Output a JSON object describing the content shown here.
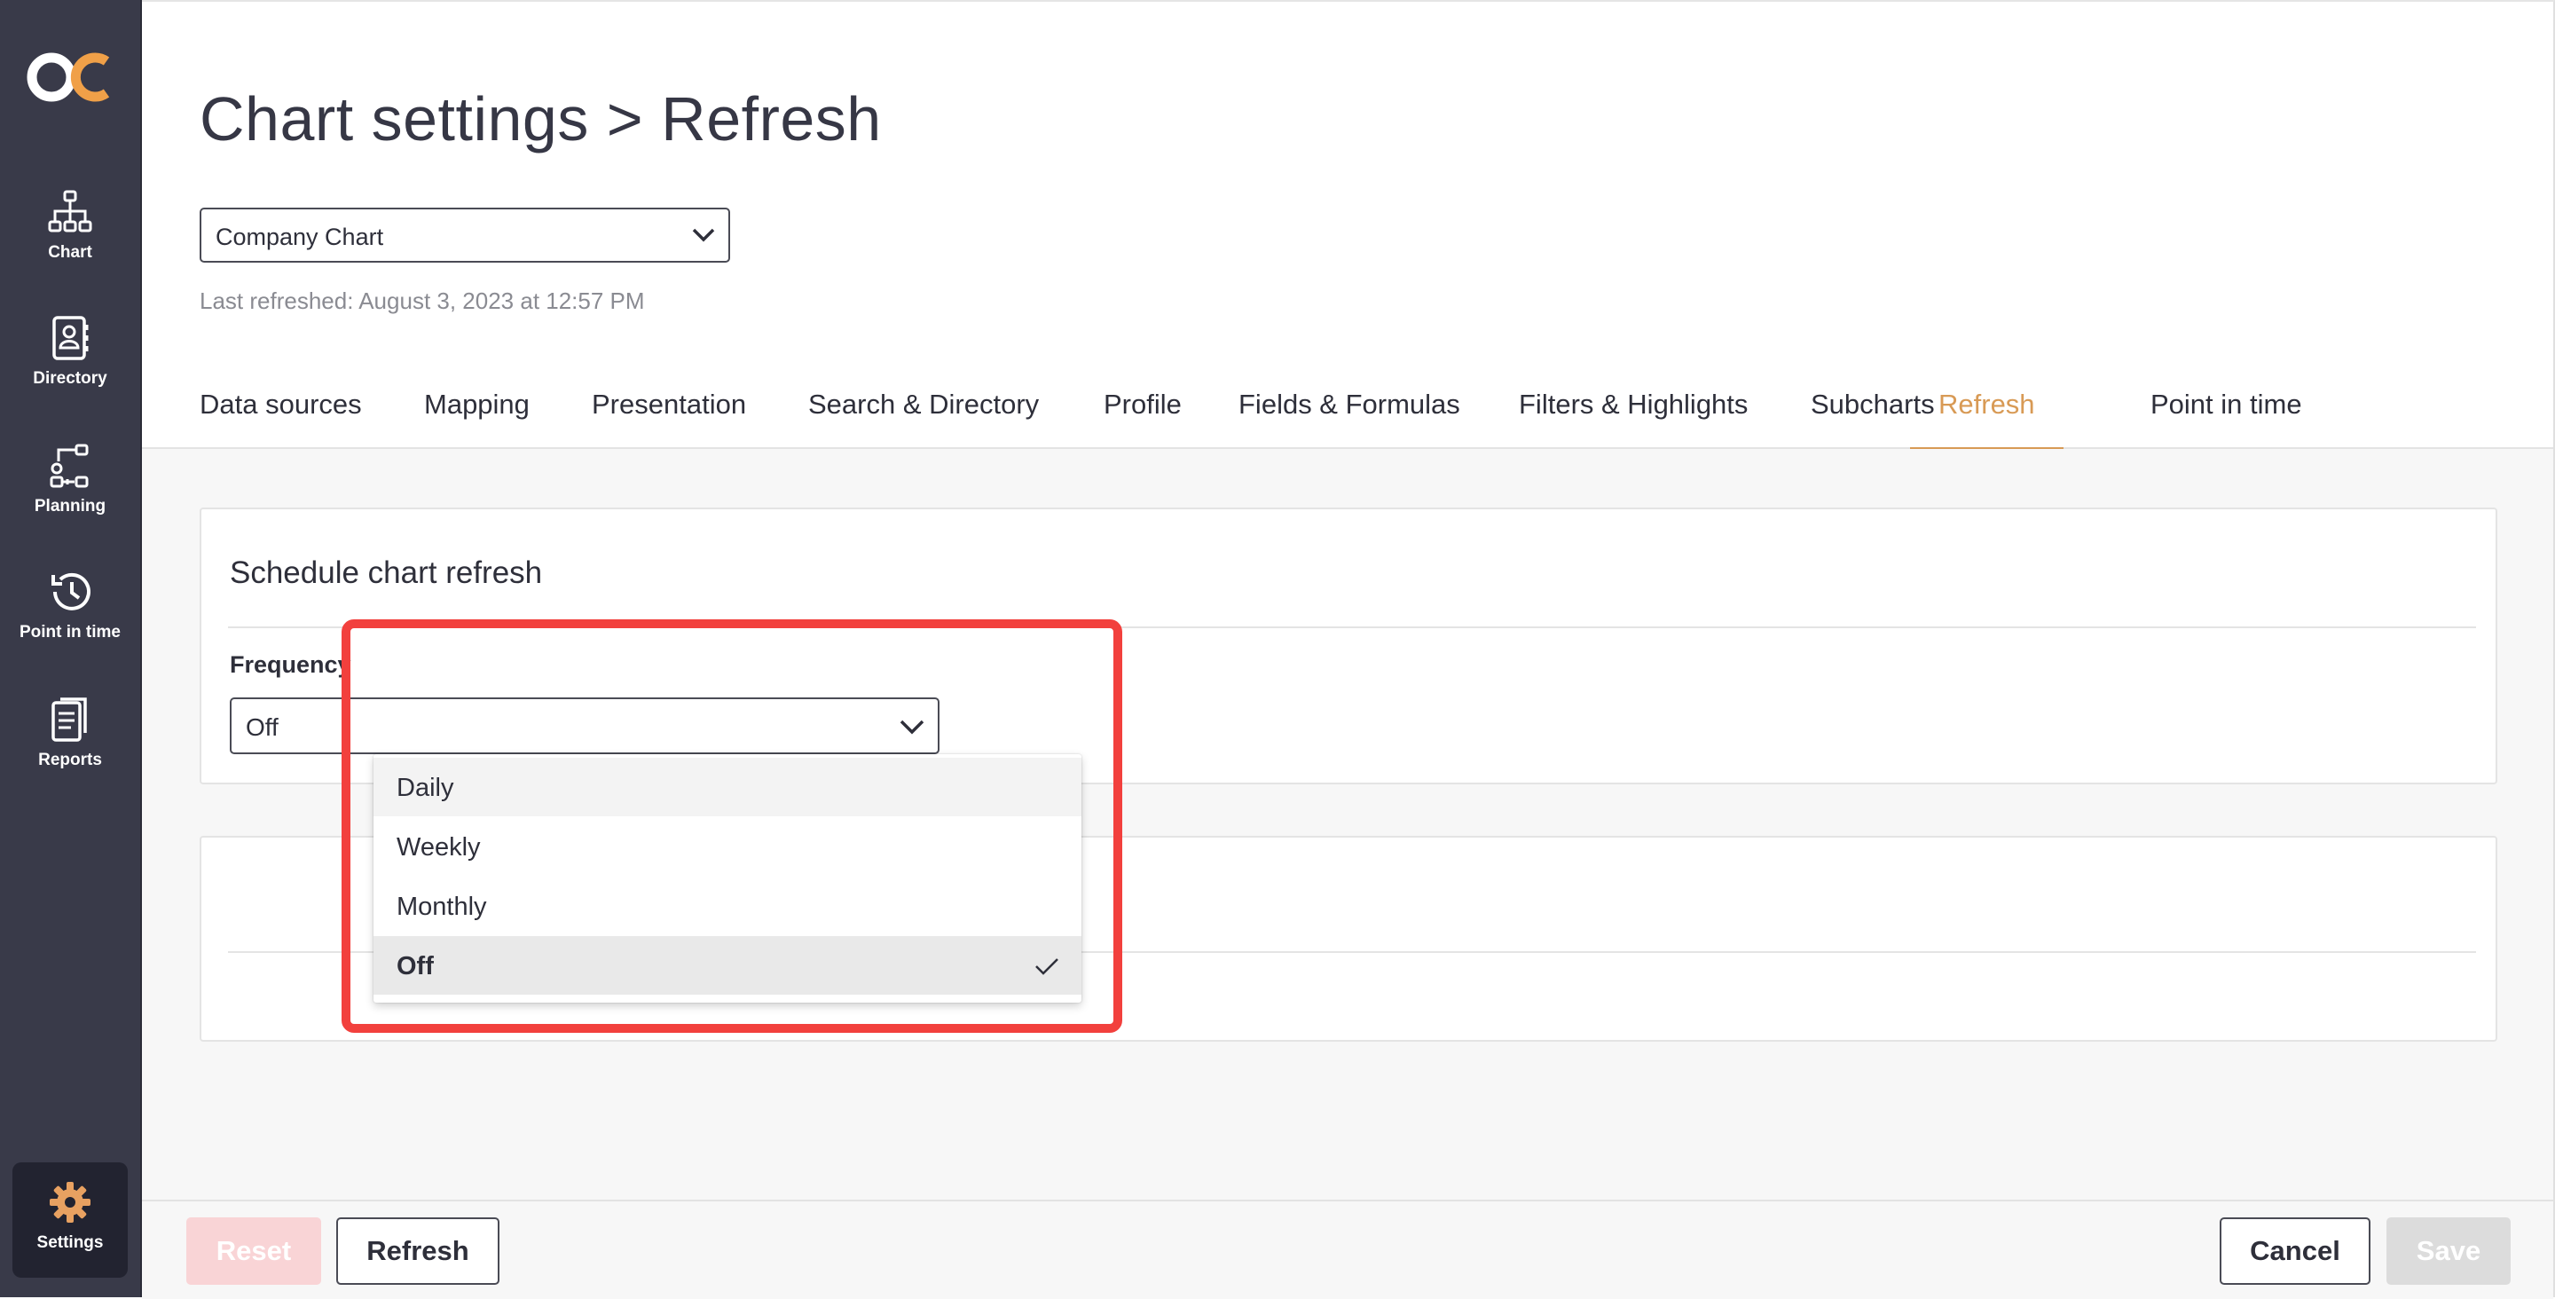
{
  "sidebar": {
    "items": [
      {
        "label": "Chart",
        "icon": "org-chart-icon"
      },
      {
        "label": "Directory",
        "icon": "contact-book-icon"
      },
      {
        "label": "Planning",
        "icon": "planning-flow-icon"
      },
      {
        "label": "Point in time",
        "icon": "history-icon"
      },
      {
        "label": "Reports",
        "icon": "report-icon"
      },
      {
        "label": "Settings",
        "icon": "gear-icon"
      }
    ],
    "logo_colors": {
      "o": "#ffffff",
      "c": "#f0a048"
    }
  },
  "header": {
    "title": "Chart settings > Refresh",
    "chart_select": "Company Chart",
    "last_refreshed": "Last refreshed: August 3, 2023 at 12:57 PM"
  },
  "tabs": [
    {
      "label": "Data sources"
    },
    {
      "label": "Mapping"
    },
    {
      "label": "Presentation"
    },
    {
      "label": "Search & Directory"
    },
    {
      "label": "Profile"
    },
    {
      "label": "Fields & Formulas"
    },
    {
      "label": "Filters & Highlights"
    },
    {
      "label": "Subcharts"
    },
    {
      "label": "Refresh",
      "active": true
    },
    {
      "label": "Point in time"
    }
  ],
  "schedule": {
    "title": "Schedule chart refresh",
    "frequency_label": "Frequency",
    "frequency_value": "Off",
    "options": [
      "Daily",
      "Weekly",
      "Monthly",
      "Off"
    ],
    "selected_option": "Off"
  },
  "footer": {
    "reset": "Reset",
    "refresh": "Refresh",
    "cancel": "Cancel",
    "save": "Save"
  },
  "colors": {
    "accent": "#d89a55",
    "sidebar_bg": "#393a49",
    "highlight": "#f2403d",
    "reset_disabled": "#f9d4d6",
    "save_disabled": "#dcdcdc"
  }
}
